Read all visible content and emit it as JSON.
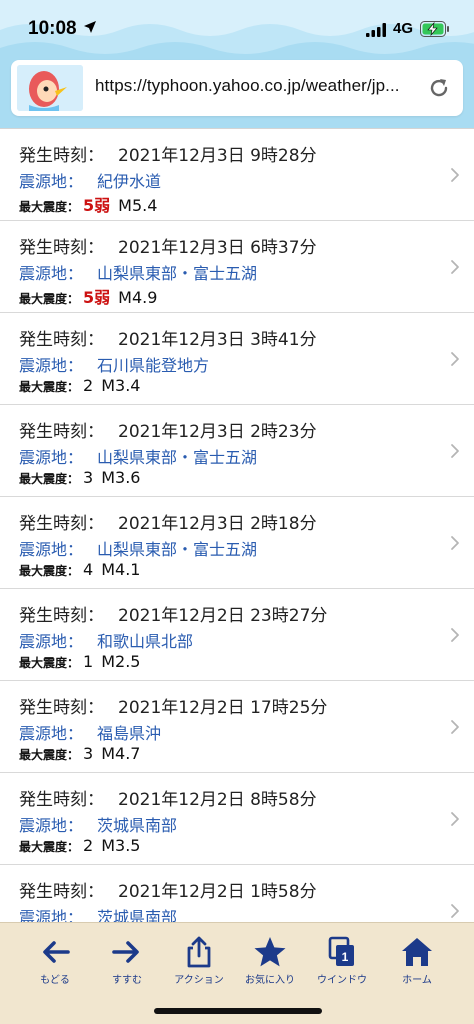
{
  "status_bar": {
    "time": "10:08",
    "network": "4G"
  },
  "browser": {
    "url": "https://typhoon.yahoo.co.jp/weather/jp..."
  },
  "labels": {
    "time": "発生時刻：",
    "epicenter": "震源地：",
    "max_intensity": "最大震度："
  },
  "quakes": [
    {
      "time": "2021年12月3日 9時28分",
      "epicenter": "紀伊水道",
      "intensity": "5弱",
      "magnitude": "M5.4",
      "highlight": true
    },
    {
      "time": "2021年12月3日 6時37分",
      "epicenter": "山梨県東部・富士五湖",
      "intensity": "5弱",
      "magnitude": "M4.9",
      "highlight": true
    },
    {
      "time": "2021年12月3日 3時41分",
      "epicenter": "石川県能登地方",
      "intensity": "2",
      "magnitude": "M3.4",
      "highlight": false
    },
    {
      "time": "2021年12月3日 2時23分",
      "epicenter": "山梨県東部・富士五湖",
      "intensity": "3",
      "magnitude": "M3.6",
      "highlight": false
    },
    {
      "time": "2021年12月3日 2時18分",
      "epicenter": "山梨県東部・富士五湖",
      "intensity": "4",
      "magnitude": "M4.1",
      "highlight": false
    },
    {
      "time": "2021年12月2日 23時27分",
      "epicenter": "和歌山県北部",
      "intensity": "1",
      "magnitude": "M2.5",
      "highlight": false
    },
    {
      "time": "2021年12月2日 17時25分",
      "epicenter": "福島県沖",
      "intensity": "3",
      "magnitude": "M4.7",
      "highlight": false
    },
    {
      "time": "2021年12月2日 8時58分",
      "epicenter": "茨城県南部",
      "intensity": "2",
      "magnitude": "M3.5",
      "highlight": false
    },
    {
      "time": "2021年12月2日 1時58分",
      "epicenter": "茨城県南部",
      "intensity": "",
      "magnitude": "",
      "highlight": false
    }
  ],
  "toolbar": {
    "back": "もどる",
    "forward": "すすむ",
    "action": "アクション",
    "favorites": "お気に入り",
    "windows": "ウインドウ",
    "windows_count": "1",
    "home": "ホーム"
  },
  "colors": {
    "epicenter_text": "#2a5cb0",
    "strong_intensity": "#cc1111",
    "toolbar_bg": "#f1e6cf",
    "toolbar_icon": "#1c3a8a",
    "header_bg": "#bfe6f7"
  },
  "icons": [
    "location-arrow-icon",
    "signal-icon",
    "battery-charging-icon",
    "reload-icon",
    "chevron-right-icon",
    "back-arrow-icon",
    "forward-arrow-icon",
    "share-icon",
    "star-icon",
    "windows-icon",
    "home-icon"
  ]
}
